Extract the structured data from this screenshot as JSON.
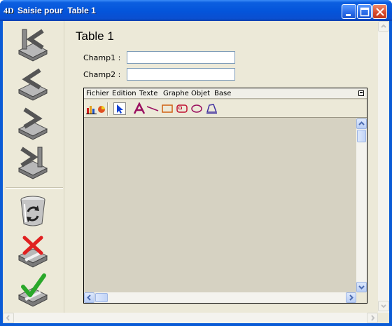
{
  "window": {
    "title": "Saisie pour  Table 1",
    "app_icon_text": "4D"
  },
  "titlebar_buttons": [
    "minimize-icon",
    "maximize-icon",
    "close-icon"
  ],
  "sidebar": {
    "buttons": [
      {
        "name": "first-record",
        "icon": "first-record-icon"
      },
      {
        "name": "previous-record",
        "icon": "previous-record-icon"
      },
      {
        "name": "next-record",
        "icon": "next-record-icon"
      },
      {
        "name": "last-record",
        "icon": "last-record-icon"
      },
      {
        "name": "delete-record",
        "icon": "trash-refresh-icon"
      },
      {
        "name": "cancel",
        "icon": "cancel-x-icon"
      },
      {
        "name": "validate",
        "icon": "validate-check-icon"
      }
    ]
  },
  "form": {
    "title": "Table 1",
    "fields": [
      {
        "label": "Champ1 :",
        "value": ""
      },
      {
        "label": "Champ2 :",
        "value": ""
      }
    ]
  },
  "graph": {
    "menu": [
      "Fichier",
      "Edition",
      "Texte",
      "Graphe",
      "Objet",
      "Base"
    ],
    "tools": [
      "chart-icon",
      "arrow-select-icon",
      "text-tool-icon",
      "line-tool-icon",
      "rectangle-tool-icon",
      "rounded-rectangle-tool-icon",
      "oval-tool-icon",
      "polygon-tool-icon"
    ]
  },
  "colors": {
    "titlebar": "#0454da",
    "window_bg": "#ece9d8",
    "validate_green": "#2aa82a",
    "cancel_red": "#e02020"
  }
}
